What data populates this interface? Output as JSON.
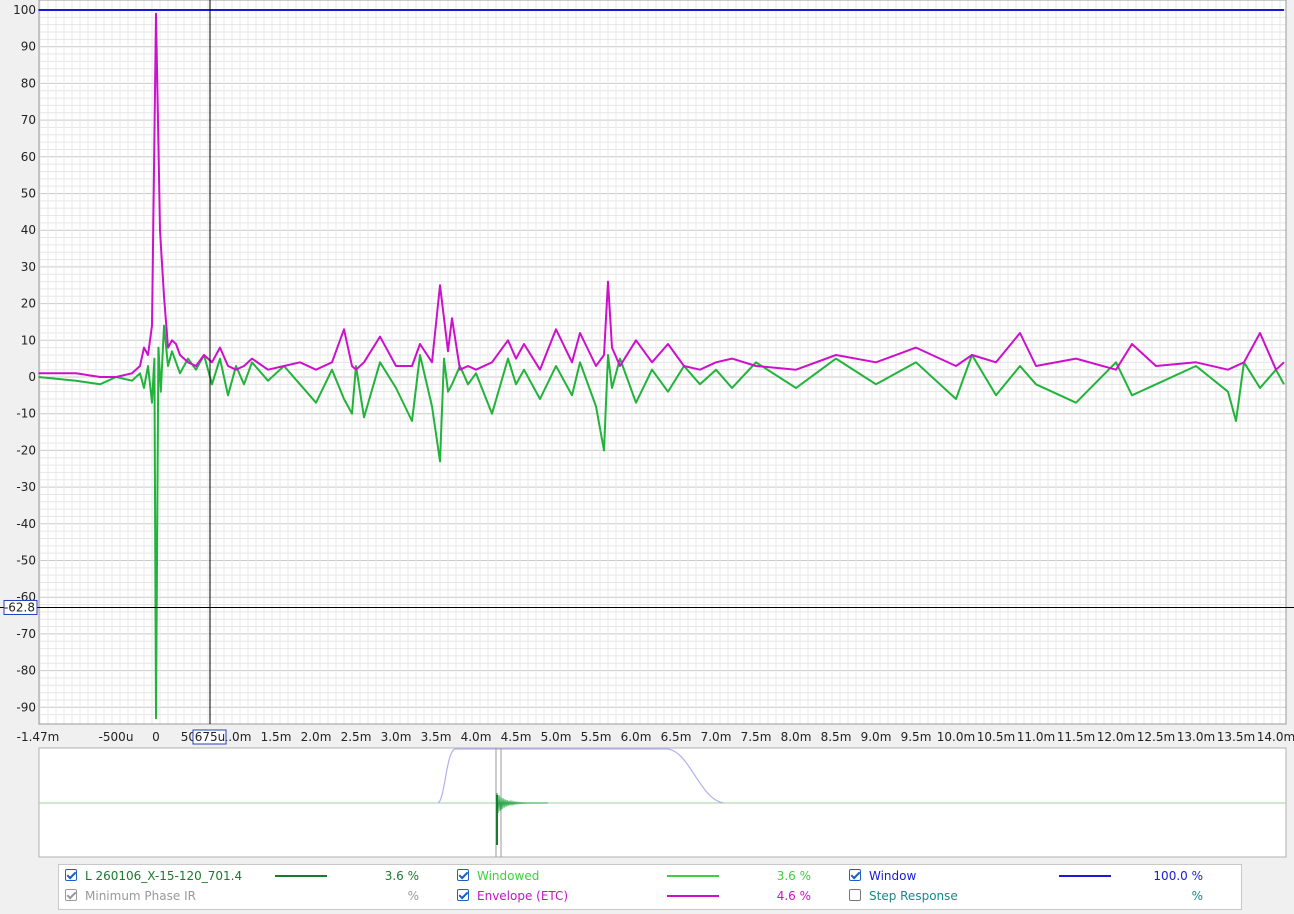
{
  "chart_data": {
    "type": "line",
    "y_axis": {
      "ticks": [
        "100",
        "90",
        "80",
        "70",
        "60",
        "50",
        "40",
        "30",
        "20",
        "10",
        "0",
        "-10",
        "-20",
        "-30",
        "-40",
        "-50",
        "-60",
        "-70",
        "-80",
        "-90"
      ],
      "ylim": [
        -93,
        100
      ],
      "unit": "%"
    },
    "x_axis": {
      "ticks": [
        "-1.47m",
        "-500u",
        "0",
        "500u",
        "1.0m",
        "1.5m",
        "2.0m",
        "2.5m",
        "3.0m",
        "3.5m",
        "4.0m",
        "4.5m",
        "5.0m",
        "5.5m",
        "6.0m",
        "6.5m",
        "7.0m",
        "7.5m",
        "8.0m",
        "8.5m",
        "9.0m",
        "9.5m",
        "10.0m",
        "10.5m",
        "11.0m",
        "11.5m",
        "12.0m",
        "12.5m",
        "13.0m",
        "13.5m",
        "14.0m"
      ],
      "xlim_ms": [
        -1.47,
        14.1
      ]
    },
    "cursor": {
      "x_label": "675u",
      "y_label": "-62.8"
    },
    "grid": true,
    "series": [
      {
        "name": "Window",
        "color": "#1a1ad6",
        "x_ms": [
          -1.47,
          14.1
        ],
        "y": [
          100,
          100
        ]
      },
      {
        "name": "Envelope (ETC)",
        "color": "#cc10cc",
        "x_ms": [
          -1.47,
          -1.0,
          -0.7,
          -0.5,
          -0.3,
          -0.2,
          -0.15,
          -0.1,
          -0.05,
          0,
          0.05,
          0.1,
          0.15,
          0.2,
          0.25,
          0.3,
          0.4,
          0.5,
          0.6,
          0.7,
          0.8,
          0.9,
          1.0,
          1.1,
          1.2,
          1.4,
          1.6,
          1.8,
          2.0,
          2.2,
          2.35,
          2.45,
          2.5,
          2.6,
          2.8,
          3.0,
          3.2,
          3.3,
          3.45,
          3.55,
          3.65,
          3.7,
          3.8,
          3.9,
          4.0,
          4.2,
          4.4,
          4.5,
          4.6,
          4.8,
          5.0,
          5.2,
          5.3,
          5.5,
          5.6,
          5.65,
          5.7,
          5.8,
          6.0,
          6.2,
          6.4,
          6.6,
          6.8,
          7.0,
          7.2,
          7.5,
          8.0,
          8.5,
          9.0,
          9.5,
          10.0,
          10.2,
          10.5,
          10.8,
          11.0,
          11.5,
          12.0,
          12.2,
          12.5,
          13.0,
          13.4,
          13.6,
          13.8,
          14.0,
          14.1
        ],
        "y": [
          1,
          1,
          0,
          0,
          1,
          3,
          8,
          6,
          14,
          99,
          40,
          22,
          8,
          10,
          9,
          6,
          4,
          3,
          6,
          4,
          8,
          3,
          2,
          3,
          5,
          2,
          3,
          4,
          2,
          4,
          13,
          3,
          2,
          4,
          11,
          3,
          3,
          9,
          4,
          25,
          7,
          16,
          2,
          3,
          2,
          4,
          10,
          5,
          9,
          2,
          13,
          4,
          12,
          3,
          6,
          26,
          8,
          3,
          10,
          4,
          9,
          3,
          2,
          4,
          5,
          3,
          2,
          6,
          4,
          8,
          3,
          6,
          4,
          12,
          3,
          5,
          2,
          9,
          3,
          4,
          2,
          4,
          12,
          2,
          4
        ]
      },
      {
        "name": "Windowed",
        "color": "#22b33b",
        "x_ms": [
          -1.47,
          -1.0,
          -0.7,
          -0.5,
          -0.3,
          -0.2,
          -0.15,
          -0.1,
          -0.05,
          -0.02,
          0,
          0.03,
          0.06,
          0.1,
          0.15,
          0.2,
          0.3,
          0.4,
          0.5,
          0.6,
          0.7,
          0.8,
          0.9,
          1.0,
          1.1,
          1.2,
          1.4,
          1.6,
          1.8,
          2.0,
          2.2,
          2.35,
          2.45,
          2.5,
          2.6,
          2.8,
          3.0,
          3.2,
          3.3,
          3.45,
          3.55,
          3.6,
          3.65,
          3.7,
          3.8,
          3.9,
          4.0,
          4.2,
          4.4,
          4.5,
          4.6,
          4.8,
          5.0,
          5.2,
          5.3,
          5.5,
          5.6,
          5.65,
          5.7,
          5.8,
          6.0,
          6.2,
          6.4,
          6.6,
          6.8,
          7.0,
          7.2,
          7.5,
          8.0,
          8.5,
          9.0,
          9.5,
          10.0,
          10.2,
          10.5,
          10.8,
          11.0,
          11.5,
          12.0,
          12.2,
          12.5,
          13.0,
          13.4,
          13.5,
          13.6,
          13.8,
          14.0,
          14.1
        ],
        "y": [
          0,
          -1,
          -2,
          0,
          -1,
          1,
          -3,
          3,
          -7,
          5,
          -93,
          8,
          -4,
          14,
          3,
          7,
          1,
          5,
          2,
          6,
          -2,
          5,
          -5,
          3,
          -2,
          4,
          -1,
          3,
          -2,
          -7,
          2,
          -6,
          -10,
          3,
          -11,
          4,
          -3,
          -12,
          6,
          -8,
          -23,
          5,
          -4,
          -2,
          3,
          -2,
          1,
          -10,
          5,
          -2,
          2,
          -6,
          3,
          -5,
          4,
          -8,
          -20,
          6,
          -3,
          5,
          -7,
          2,
          -4,
          3,
          -2,
          2,
          -3,
          4,
          -3,
          5,
          -2,
          4,
          -6,
          6,
          -5,
          3,
          -2,
          -7,
          4,
          -5,
          -2,
          3,
          -4,
          -12,
          4,
          -3,
          2,
          -2
        ]
      }
    ]
  },
  "overview": {
    "label": "overview-strip"
  },
  "legend": {
    "rows": [
      [
        {
          "label": "L 260106_X-15-120_701.4",
          "checked": true,
          "dim": false,
          "color": "#1a7a2e",
          "pct": "3.6 %"
        },
        {
          "label": "Windowed",
          "checked": true,
          "dim": false,
          "color": "#3ecf3e",
          "pct": "3.6 %"
        },
        {
          "label": "Window",
          "checked": true,
          "dim": false,
          "color": "#1a1ad6",
          "pct": "100.0 %"
        }
      ],
      [
        {
          "label": "Minimum Phase IR",
          "checked": true,
          "dim": true,
          "color": "#999999",
          "pct": "%"
        },
        {
          "label": "Envelope (ETC)",
          "checked": true,
          "dim": false,
          "color": "#cc10cc",
          "pct": "4.6 %"
        },
        {
          "label": "Step Response",
          "checked": false,
          "dim": false,
          "color": "#138a8a",
          "pct": "%"
        }
      ]
    ]
  }
}
